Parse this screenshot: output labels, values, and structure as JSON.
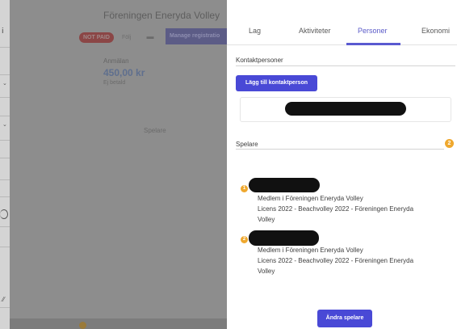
{
  "background": {
    "left_letter": "i",
    "team_name": "Föreningen Eneryda Volley",
    "status_badge": "NOT PAID",
    "follow_label": "Följ",
    "chat_icon": "chat-icon",
    "manage_button": "Manage registratio",
    "anmalan_label": "Anmälan",
    "amount": "450,00 kr",
    "paid_status": "Ej betald",
    "spelare_label": "Spelare",
    "bottom_dot": "2"
  },
  "tabs": [
    {
      "label": "Lag"
    },
    {
      "label": "Aktiviteter"
    },
    {
      "label": "Personer"
    },
    {
      "label": "Ekonomi"
    }
  ],
  "active_tab": "Personer",
  "contacts": {
    "title": "Kontaktpersoner",
    "add_button": "Lägg till kontaktperson"
  },
  "players": {
    "title": "Spelare",
    "count": "2",
    "items": [
      {
        "number": "1",
        "lines": [
          "Medlem i Föreningen Eneryda Volley",
          "Licens 2022 - Beachvolley 2022 - Föreningen Eneryda",
          "Volley"
        ]
      },
      {
        "number": "2",
        "lines": [
          "Medlem i Föreningen Eneryda Volley",
          "Licens 2022 - Beachvolley 2022 - Föreningen Eneryda",
          "Volley"
        ]
      }
    ],
    "change_button": "Ändra spelare"
  },
  "colors": {
    "accent": "#4949d6",
    "badge": "#efa82e"
  }
}
